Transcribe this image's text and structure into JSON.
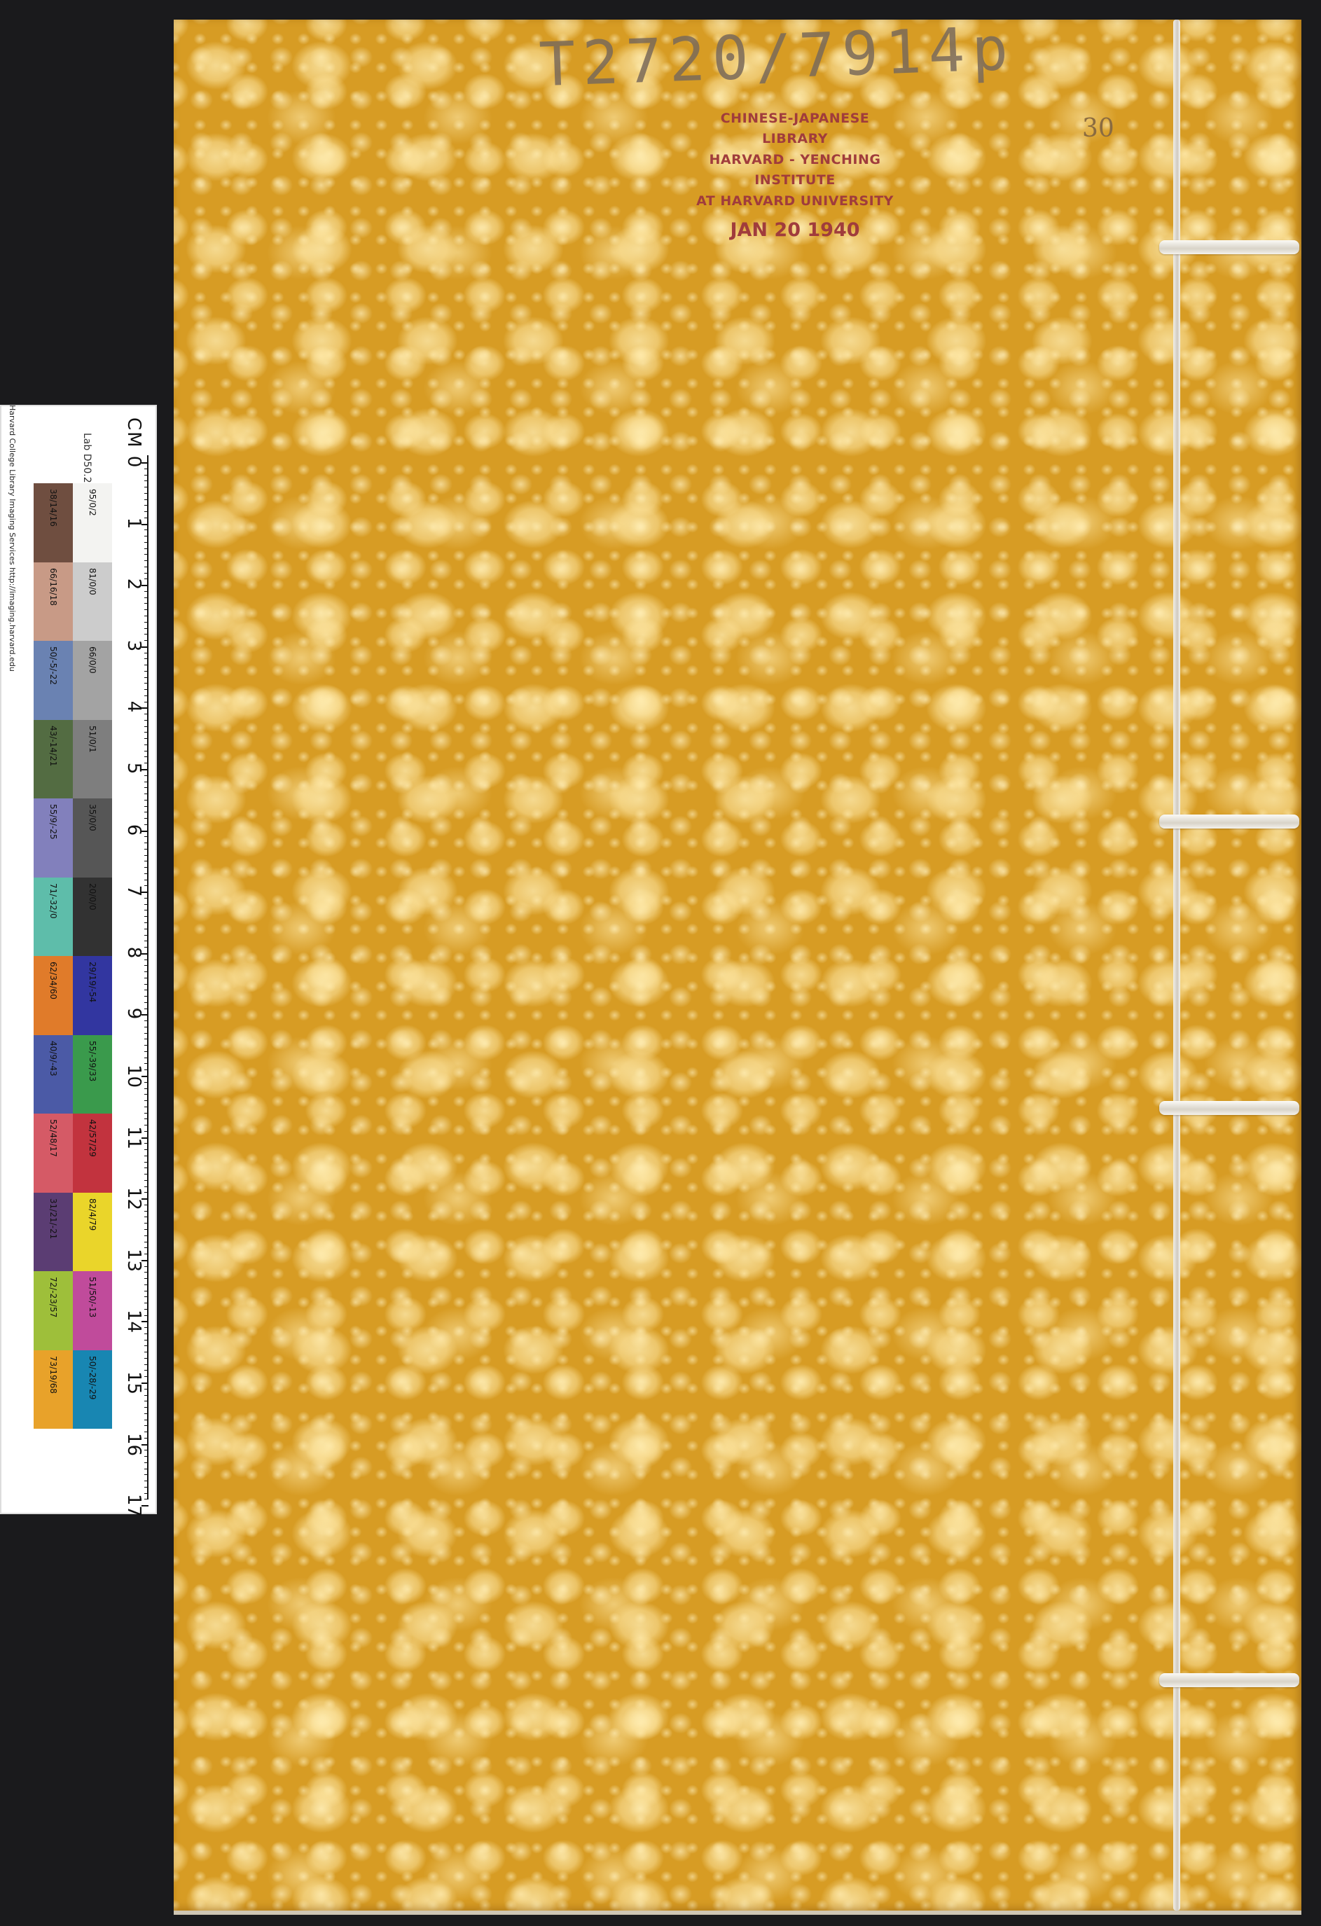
{
  "cover": {
    "handwritten_call_number": "T2720/7914p",
    "stamp": {
      "line1": "CHINESE-JAPANESE LIBRARY",
      "line2": "HARVARD - YENCHING INSTITUTE",
      "line3": "AT HARVARD UNIVERSITY",
      "date": "JAN 20 1940"
    },
    "volume_number": "30",
    "color": "#d79c24"
  },
  "color_target": {
    "credit": "Harvard College Library Imaging Services http://imaging.harvard.edu",
    "lab_label": "Lab D50.2°",
    "ruler_unit": "CM",
    "ruler_numbers": [
      "0",
      "1",
      "2",
      "3",
      "4",
      "5",
      "6",
      "7",
      "8",
      "9",
      "10",
      "11",
      "12",
      "13",
      "14",
      "15",
      "16",
      "17"
    ],
    "swatches_right": [
      {
        "label": "95/0/2",
        "color": "#f3f3f1"
      },
      {
        "label": "81/0/0",
        "color": "#cccccc"
      },
      {
        "label": "66/0/0",
        "color": "#a3a3a3"
      },
      {
        "label": "51/0/1",
        "color": "#7e7e7e"
      },
      {
        "label": "35/0/0",
        "color": "#565656"
      },
      {
        "label": "20/0/0",
        "color": "#323232"
      },
      {
        "label": "29/19/-54",
        "color": "#3236a0"
      },
      {
        "label": "55/-39/33",
        "color": "#3a9a4c"
      },
      {
        "label": "42/57/29",
        "color": "#c2333e"
      },
      {
        "label": "82/4/79",
        "color": "#ead52a"
      },
      {
        "label": "51/50/-13",
        "color": "#c04b9b"
      },
      {
        "label": "50/-28/-29",
        "color": "#1886b2"
      }
    ],
    "swatches_left": [
      {
        "label": "38/14/16",
        "color": "#6f4e40"
      },
      {
        "label": "66/16/18",
        "color": "#c89a86"
      },
      {
        "label": "50/-5/-22",
        "color": "#6a82b2"
      },
      {
        "label": "43/-14/21",
        "color": "#536c42"
      },
      {
        "label": "55/9/-25",
        "color": "#8280bc"
      },
      {
        "label": "71/-32/0",
        "color": "#5ebdaa"
      },
      {
        "label": "62/34/60",
        "color": "#e07b2a"
      },
      {
        "label": "40/9/-43",
        "color": "#4b5aa6"
      },
      {
        "label": "52/48/17",
        "color": "#d55a66"
      },
      {
        "label": "31/21/-21",
        "color": "#5b3d73"
      },
      {
        "label": "72/-23/57",
        "color": "#9ebf3a"
      },
      {
        "label": "73/19/68",
        "color": "#e8a22a"
      }
    ]
  }
}
